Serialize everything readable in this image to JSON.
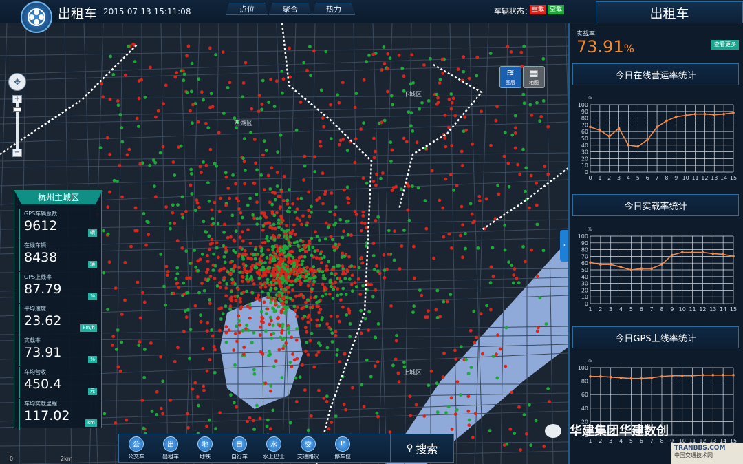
{
  "header": {
    "app_title": "出租车",
    "datetime": "2015-07-13 15:11:08",
    "tabs": [
      {
        "label": "点位",
        "icon": "location-icon"
      },
      {
        "label": "聚合",
        "icon": "cluster-icon"
      },
      {
        "label": "热力",
        "icon": "heatmap-icon"
      }
    ],
    "vehicle_status_label": "车辆状态：",
    "status_badges": [
      {
        "label": "重载",
        "color": "#d9261c"
      },
      {
        "label": "空载",
        "color": "#1fa83a"
      }
    ],
    "right_title": "出租车"
  },
  "map": {
    "layer_buttons": [
      "图层",
      "地图"
    ],
    "districts": [
      "下城区",
      "西湖区",
      "上城区"
    ],
    "scale_labels": [
      "0",
      "2km"
    ]
  },
  "left_panel": {
    "title": "杭州主城区",
    "stats": [
      {
        "label": "GPS车辆总数",
        "value": "9612",
        "unit": "辆"
      },
      {
        "label": "在线车辆",
        "value": "8438",
        "unit": "辆"
      },
      {
        "label": "GPS上线率",
        "value": "87.79",
        "unit": "%"
      },
      {
        "label": "平均速度",
        "value": "23.62",
        "unit": "km/h"
      },
      {
        "label": "实载率",
        "value": "73.91",
        "unit": "%"
      },
      {
        "label": "车均营收",
        "value": "450.4",
        "unit": "元"
      },
      {
        "label": "车均实载里程",
        "value": "117.02",
        "unit": "km"
      }
    ]
  },
  "right_panel": {
    "rate_label": "实载率",
    "rate_value": "73.91",
    "rate_unit": "%",
    "more_label": "查看更多",
    "charts": [
      {
        "title": "今日在线营运率统计",
        "ylabel": "%",
        "x": [
          0,
          1,
          2,
          3,
          4,
          5,
          6,
          7,
          8,
          9,
          10,
          11,
          12,
          13,
          14,
          15
        ],
        "values": [
          67,
          62,
          53,
          65,
          40,
          38,
          48,
          67,
          76,
          82,
          84,
          86,
          86,
          85,
          86,
          88
        ],
        "ylim": [
          0,
          100
        ],
        "yticks": [
          0,
          10,
          20,
          30,
          40,
          50,
          60,
          70,
          80,
          90,
          100
        ]
      },
      {
        "title": "今日实载率统计",
        "ylabel": "%",
        "x": [
          1,
          2,
          3,
          4,
          5,
          6,
          7,
          8,
          9,
          10,
          11,
          12,
          13,
          14,
          15
        ],
        "values": [
          61,
          58,
          58,
          54,
          50,
          52,
          52,
          58,
          72,
          76,
          76,
          76,
          74,
          73,
          70
        ],
        "ylim": [
          0,
          100
        ],
        "yticks": [
          0,
          10,
          20,
          30,
          40,
          50,
          60,
          70,
          80,
          90,
          100
        ]
      },
      {
        "title": "今日GPS上线率统计",
        "ylabel": "%",
        "x": [
          1,
          2,
          3,
          4,
          5,
          6,
          7,
          8,
          9,
          10,
          11,
          12,
          13,
          14,
          15
        ],
        "values": [
          87,
          87,
          86,
          85,
          84,
          84,
          85,
          87,
          88,
          88,
          88,
          89,
          89,
          89,
          89
        ],
        "ylim": [
          0,
          100
        ],
        "yticks": [
          0,
          20,
          40,
          60,
          80,
          100
        ]
      }
    ]
  },
  "bottom_bar": {
    "items": [
      {
        "label": "公交车",
        "icon": "bus-icon",
        "glyph": "公"
      },
      {
        "label": "出租车",
        "icon": "taxi-icon",
        "glyph": "出"
      },
      {
        "label": "地铁",
        "icon": "subway-icon",
        "glyph": "地"
      },
      {
        "label": "自行车",
        "icon": "bicycle-icon",
        "glyph": "自"
      },
      {
        "label": "水上巴士",
        "icon": "water-bus-icon",
        "glyph": "水"
      },
      {
        "label": "交通路况",
        "icon": "traffic-light-icon",
        "glyph": "交"
      },
      {
        "label": "停车位",
        "icon": "parking-icon",
        "glyph": "P"
      }
    ],
    "search_label": "搜索"
  },
  "watermark": {
    "text": "华建集团华建数创",
    "site_name": "TRANBBS.COM",
    "site_sub": "中国交通技术网"
  }
}
